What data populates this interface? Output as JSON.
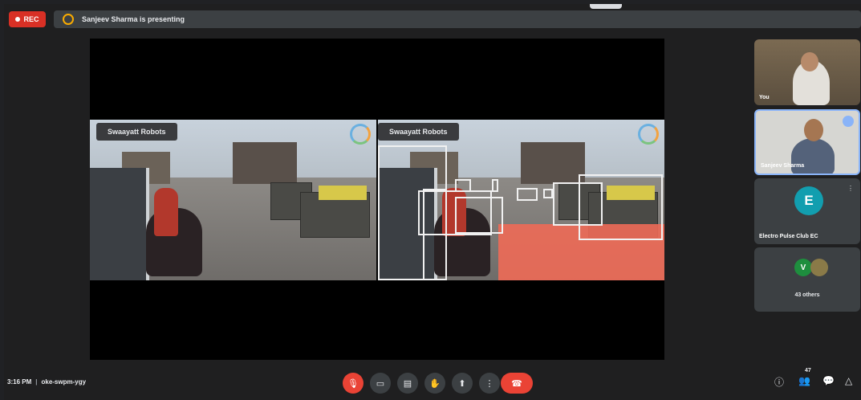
{
  "recording": {
    "label": "REC"
  },
  "presenting": {
    "text": "Sanjeev Sharma is presenting"
  },
  "slide": {
    "left_label": "Swaayatt Robots",
    "right_label": "Swaayatt Robots"
  },
  "participants": [
    {
      "name": "You"
    },
    {
      "name": "Sanjeev Sharma"
    },
    {
      "name": "Electro Pulse Club EC",
      "initial": "E"
    },
    {
      "name": "43 others",
      "initial": "V"
    }
  ],
  "bottom": {
    "time": "3:16 PM",
    "meeting_code": "oke-swpm-ygy",
    "participant_count": "47"
  },
  "colors": {
    "record": "#d93025",
    "hangup": "#ea4335",
    "avatar_e": "#129eaf",
    "avatar_v": "#1e8e3e"
  }
}
